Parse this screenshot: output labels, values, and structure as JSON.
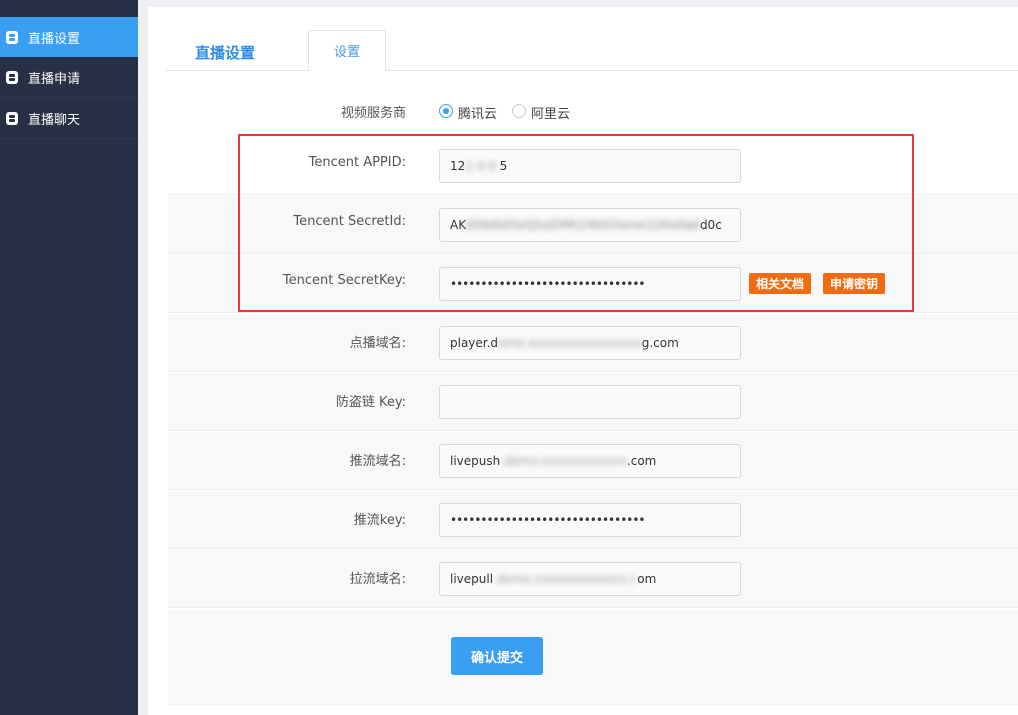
{
  "sidebar": {
    "items": [
      {
        "label": "直播设置",
        "icon": "document-icon",
        "active": true
      },
      {
        "label": "直播申请",
        "icon": "document-icon",
        "active": false
      },
      {
        "label": "直播聊天",
        "icon": "document-icon",
        "active": false
      }
    ]
  },
  "tabs": {
    "main_label": "直播设置",
    "settings_label": "设置"
  },
  "provider": {
    "label": "视频服务商",
    "options": [
      {
        "label": "腾讯云",
        "selected": true
      },
      {
        "label": "阿里云",
        "selected": false
      }
    ]
  },
  "form": {
    "tencent_appid": {
      "label": "Tencent APPID:",
      "value_visible_start": "12",
      "value_visible_end": "5"
    },
    "tencent_secretid": {
      "label": "Tencent SecretId:",
      "value_visible_start": "AK",
      "value_visible_end": "d0c"
    },
    "tencent_secretkey": {
      "label": "Tencent SecretKey:",
      "value": "••••••••••••••••••••••••••••••••"
    },
    "vod_domain": {
      "label": "点播域名:",
      "value_visible_start": "player.d",
      "value_visible_end": "g.com"
    },
    "anti_leech_key": {
      "label": "防盗链 Key:",
      "value": ""
    },
    "push_domain": {
      "label": "推流域名:",
      "value_visible_start": "livepush",
      "value_visible_end": ".com"
    },
    "push_key": {
      "label": "推流key:",
      "value": "••••••••••••••••••••••••••••••••"
    },
    "pull_domain": {
      "label": "拉流域名:",
      "value_visible_start": "livepull",
      "value_visible_end": "om"
    }
  },
  "buttons": {
    "docs": "相关文档",
    "apply_key": "申请密钥",
    "submit": "确认提交"
  },
  "colors": {
    "sidebar_bg": "#273045",
    "accent": "#3a9ef3",
    "orange": "#f26b0f",
    "highlight": "#e8393b"
  }
}
